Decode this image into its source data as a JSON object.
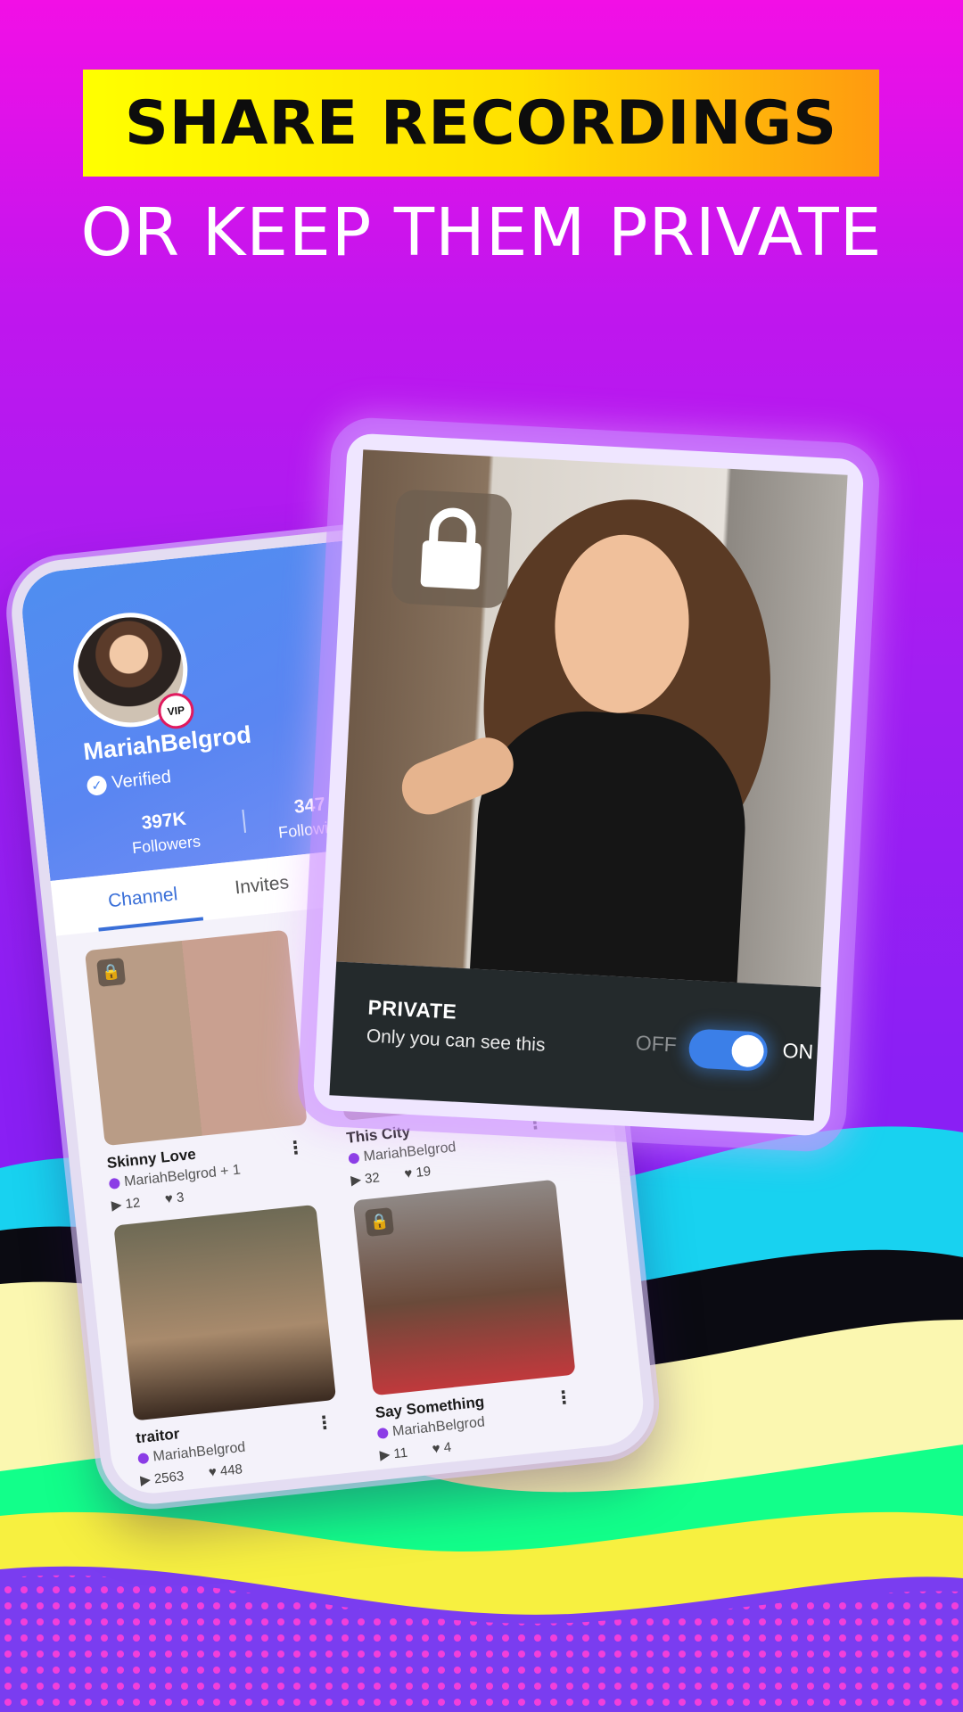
{
  "headline": "SHARE RECORDINGS",
  "subheadline": "OR KEEP THEM PRIVATE",
  "profile": {
    "username": "MariahBelgrod",
    "badge": "VIP",
    "verified_label": "Verified",
    "followers_count": "397K",
    "followers_label": "Followers",
    "following_count": "347",
    "following_label": "Following"
  },
  "tabs": [
    {
      "label": "Channel",
      "active": true
    },
    {
      "label": "Invites",
      "active": false
    }
  ],
  "recordings": [
    {
      "title": "Skinny Love",
      "user": "MariahBelgrod + 1",
      "plays": "12",
      "likes": "3",
      "private": true
    },
    {
      "title": "This City",
      "user": "MariahBelgrod",
      "plays": "32",
      "likes": "19",
      "private": false
    },
    {
      "title": "traitor",
      "user": "MariahBelgrod",
      "plays": "2563",
      "likes": "448",
      "private": false
    },
    {
      "title": "Say Something",
      "user": "MariahBelgrod",
      "plays": "11",
      "likes": "4",
      "private": true
    }
  ],
  "private_panel": {
    "title": "PRIVATE",
    "subtitle": "Only you can see this",
    "off_label": "OFF",
    "on_label": "ON",
    "toggle_on": true
  },
  "icons": {
    "lock": "lock-icon",
    "verified": "verified-check-icon",
    "play": "play-icon",
    "like": "heart-icon",
    "more": "more-vertical-icon"
  },
  "colors": {
    "headline_yellow": "#ffff00",
    "headline_orange": "#ff9a10",
    "accent_blue": "#3b7fe8",
    "background_magenta": "#f20fe6",
    "background_purple": "#8b1ff4"
  }
}
